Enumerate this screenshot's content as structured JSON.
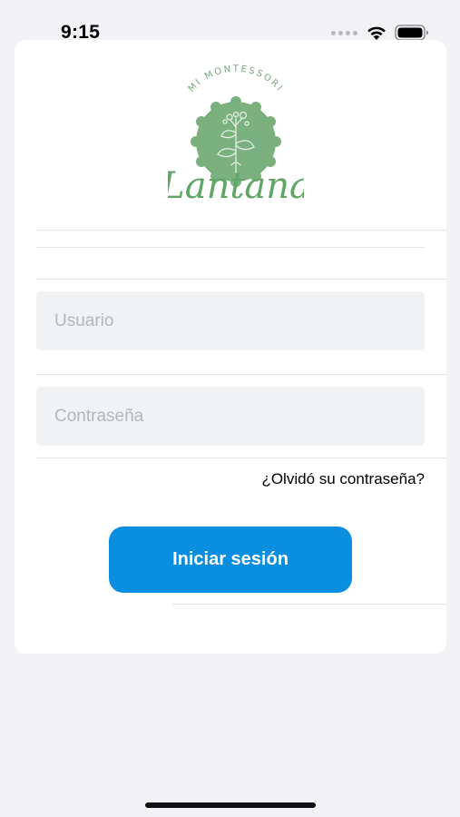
{
  "status_bar": {
    "time": "9:15",
    "icons": [
      "signal-dots-icon",
      "wifi-icon",
      "battery-icon"
    ]
  },
  "logo": {
    "tagline": "MI MONTESSORI",
    "name": "Lantana",
    "icon": "lantana-plant-icon",
    "colors": {
      "badge": "#7bb07f",
      "text": "#5fa565"
    }
  },
  "form": {
    "username_placeholder": "Usuario",
    "password_placeholder": "Contraseña",
    "forgot_label": "¿Olvidó su contraseña?",
    "login_label": "Iniciar sesión"
  },
  "colors": {
    "primary": "#0a8ee0",
    "field_bg": "#f0f2f4",
    "background": "#f2f2f7"
  }
}
